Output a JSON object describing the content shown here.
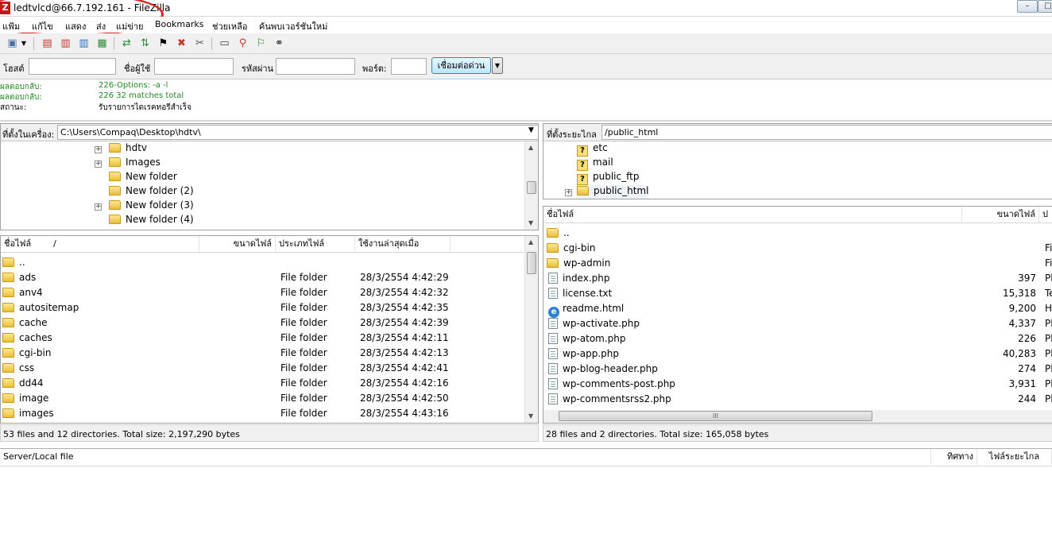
{
  "window": {
    "title": "ledtvlcd@66.7.192.161 - FileZilla",
    "app_icon_letter": "Z",
    "controls": [
      "–",
      "□"
    ]
  },
  "menu": [
    "แฟ้ม",
    "แก้ไข",
    "แสดง",
    "ส่ง",
    "แม่ข่าย",
    "Bookmarks",
    "ช่วยเหลือ",
    "ค้นพบเวอร์ชันใหม่"
  ],
  "toolbar": {
    "icons": [
      "site-manager-icon",
      "dropdown-icon",
      "message-log-icon",
      "local-tree-icon",
      "remote-tree-icon",
      "transfer-queue-icon",
      "refresh-icon",
      "process-queue-icon",
      "filter-icon",
      "cancel-icon",
      "disconnect-icon",
      "reconnect-icon",
      "compare-icon",
      "sync-browse-icon",
      "search-icon",
      "binoculars-icon"
    ]
  },
  "quickconnect": {
    "host_label": "โฮสต์",
    "host_value": "",
    "user_label": "ชื่อผู้ใช้",
    "user_value": "",
    "pass_label": "รหัสผ่าน",
    "pass_value": "",
    "port_label": "พอร์ต:",
    "port_value": "",
    "connect_label": "เชื่อมต่อด่วน",
    "dropdown_glyph": "▼"
  },
  "log": [
    {
      "label": "ผลตอบกลับ:",
      "message": "226-Options: -a -l",
      "color": "green"
    },
    {
      "label": "ผลตอบกลับ:",
      "message": "226 32 matches total",
      "color": "green"
    },
    {
      "label": "สถานะ:",
      "message": "รับรายการไดเรคทอรีสำเร็จ",
      "color": "black"
    }
  ],
  "local": {
    "path_label": "ที่ตั้งในเครื่อง:",
    "path": "C:\\Users\\Compaq\\Desktop\\hdtv\\",
    "tree": [
      {
        "name": "hdtv",
        "expander": "+"
      },
      {
        "name": "Images",
        "expander": "+"
      },
      {
        "name": "New folder",
        "expander": ""
      },
      {
        "name": "New folder (2)",
        "expander": ""
      },
      {
        "name": "New folder (3)",
        "expander": "+"
      },
      {
        "name": "New folder (4)",
        "expander": ""
      }
    ],
    "columns": [
      "ชื่อไฟล์",
      "/",
      "ขนาดไฟล์",
      "ประเภทไฟล์",
      "ใช้งานล่าสุดเมื่อ"
    ],
    "files": [
      {
        "name": "..",
        "size": "",
        "type": "",
        "modified": ""
      },
      {
        "name": "ads",
        "size": "",
        "type": "File folder",
        "modified": "28/3/2554 4:42:29"
      },
      {
        "name": "anv4",
        "size": "",
        "type": "File folder",
        "modified": "28/3/2554 4:42:32"
      },
      {
        "name": "autositemap",
        "size": "",
        "type": "File folder",
        "modified": "28/3/2554 4:42:35"
      },
      {
        "name": "cache",
        "size": "",
        "type": "File folder",
        "modified": "28/3/2554 4:42:39"
      },
      {
        "name": "caches",
        "size": "",
        "type": "File folder",
        "modified": "28/3/2554 4:42:11"
      },
      {
        "name": "cgi-bin",
        "size": "",
        "type": "File folder",
        "modified": "28/3/2554 4:42:13"
      },
      {
        "name": "css",
        "size": "",
        "type": "File folder",
        "modified": "28/3/2554 4:42:41"
      },
      {
        "name": "dd44",
        "size": "",
        "type": "File folder",
        "modified": "28/3/2554 4:42:16"
      },
      {
        "name": "image",
        "size": "",
        "type": "File folder",
        "modified": "28/3/2554 4:42:50"
      },
      {
        "name": "images",
        "size": "",
        "type": "File folder",
        "modified": "28/3/2554 4:43:16"
      }
    ],
    "status": "53 files and 12 directories. Total size: 2,197,290 bytes"
  },
  "remote": {
    "path_label": "ที่ตั้งระยะไกล",
    "path": "/public_html",
    "tree": [
      {
        "name": "etc",
        "icon": "question",
        "expander": ""
      },
      {
        "name": "mail",
        "icon": "question",
        "expander": ""
      },
      {
        "name": "public_ftp",
        "icon": "question",
        "expander": ""
      },
      {
        "name": "public_html",
        "icon": "folder",
        "expander": "+"
      }
    ],
    "columns": [
      "ชื่อไฟล์",
      "ขนาดไฟล์",
      "ป"
    ],
    "files": [
      {
        "name": "..",
        "icon": "folder",
        "size": "",
        "type": ""
      },
      {
        "name": "cgi-bin",
        "icon": "folder",
        "size": "",
        "type": "Fi"
      },
      {
        "name": "wp-admin",
        "icon": "folder",
        "size": "",
        "type": "Fi"
      },
      {
        "name": "index.php",
        "icon": "doc",
        "size": "397",
        "type": "Pl"
      },
      {
        "name": "license.txt",
        "icon": "doc",
        "size": "15,318",
        "type": "Te"
      },
      {
        "name": "readme.html",
        "icon": "ie",
        "size": "9,200",
        "type": "H"
      },
      {
        "name": "wp-activate.php",
        "icon": "doc",
        "size": "4,337",
        "type": "Pl"
      },
      {
        "name": "wp-atom.php",
        "icon": "doc",
        "size": "226",
        "type": "Pl"
      },
      {
        "name": "wp-app.php",
        "icon": "doc",
        "size": "40,283",
        "type": "Pl"
      },
      {
        "name": "wp-blog-header.php",
        "icon": "doc",
        "size": "274",
        "type": "Pl"
      },
      {
        "name": "wp-comments-post.php",
        "icon": "doc",
        "size": "3,931",
        "type": "Pl"
      },
      {
        "name": "wp-commentsrss2.php",
        "icon": "doc",
        "size": "244",
        "type": "Pl"
      }
    ],
    "hscroll_grip": "III",
    "status": "28 files and 2 directories. Total size: 165,058 bytes"
  },
  "queue": {
    "columns": [
      "Server/Local file",
      "ทิศทาง",
      "ไฟล์ระยะไกล"
    ]
  }
}
